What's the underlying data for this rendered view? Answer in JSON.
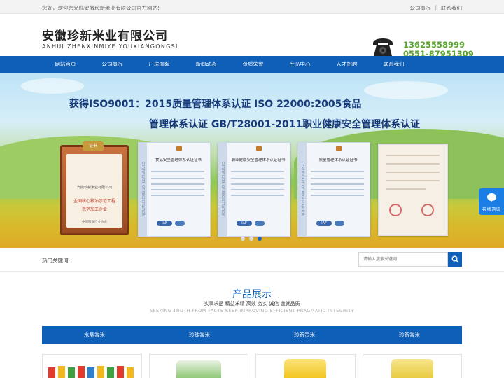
{
  "topbar": {
    "welcome": "您好，欢迎您光临安徽珍新米业有限公司官方网站!",
    "links": [
      "公司概况",
      "联系我们"
    ],
    "separator": "|"
  },
  "header": {
    "company_cn": "安徽珍新米业有限公司",
    "company_en": "ANHUI ZHENXINMIYE YOUXIANGONGSI",
    "phone_mobile": "13625558999",
    "phone_landline": "0551-87951309"
  },
  "nav": {
    "items": [
      "网站首页",
      "公司概况",
      "厂房面貌",
      "新闻动态",
      "资质荣誉",
      "产品中心",
      "人才招聘",
      "联系我们"
    ]
  },
  "banner": {
    "title_line1": "获得ISO9001：2015质量管理体系认证 ISO 22000:2005食品",
    "title_line2": "管理体系认证 GB/T28001-2011职业健康安全管理体系认证",
    "plaque_seal": "证书",
    "plaque_company": "安徽珍新米业有限公司",
    "plaque_line1": "全国核心粮油示范工程",
    "plaque_line2": "示范加工企业",
    "plaque_issuer": "中国粮食行业协会",
    "cert_band": "CERTIFICATE OF REGISTRATION",
    "cert_titles": [
      "食品安全管理体系认证证书",
      "职业健康安全管理体系认证证书",
      "质量管理体系认证证书"
    ],
    "cert_iaf": "IAF",
    "active_slide": 3,
    "slide_count": 3
  },
  "float_chat": {
    "label": "在线咨询"
  },
  "search": {
    "hot_label": "热门关键词:",
    "placeholder": "请输入搜索关键词"
  },
  "products_section": {
    "title": "产品展示",
    "subtitle": "实事求是 精益求精 高效 务实 诚信 造就品质",
    "subtitle_en": "SEEKING TRUTH FROM FACTS KEEP IMPROVING EFFICIENT PRAGMATIC INTEGRITY",
    "categories": [
      "水晶香米",
      "珍珠香米",
      "珍新贡米",
      "珍新香米"
    ]
  },
  "colors": {
    "nav_blue": "#0d5fb8",
    "phone_green": "#5aa630",
    "banner_title": "#163a79"
  }
}
